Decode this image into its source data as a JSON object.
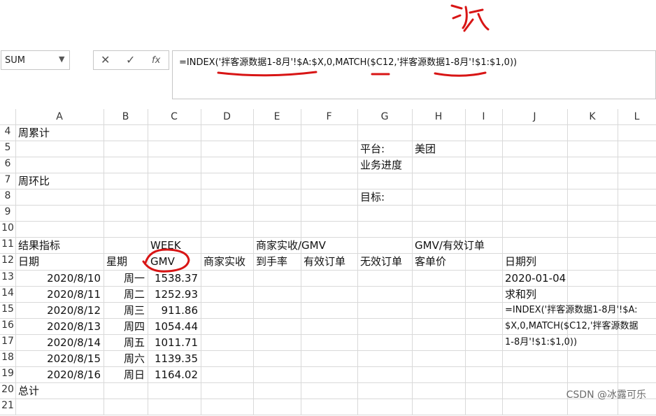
{
  "formula_bar": {
    "name_box": "SUM",
    "cancel_icon": "✕",
    "enter_icon": "✓",
    "fx_label": "fx",
    "formula": "=INDEX('拌客源数据1-8月'!$A:$X,0,MATCH($C12,'拌客源数据1-8月'!$1:$1,0))"
  },
  "column_headers": [
    "A",
    "B",
    "C",
    "D",
    "E",
    "F",
    "G",
    "H",
    "I",
    "J",
    "K",
    "L"
  ],
  "row_headers": [
    "4",
    "5",
    "6",
    "7",
    "8",
    "9",
    "10",
    "11",
    "12",
    "13",
    "14",
    "15",
    "16",
    "17",
    "18",
    "19",
    "20",
    "21"
  ],
  "cells": {
    "A4": "周累计",
    "G5": "平台:",
    "H5": "美团",
    "G6": "业务进度",
    "A7": "周环比",
    "G8": "目标:",
    "A11": "结果指标",
    "C11": "WEEK",
    "E11": "商家实收/GMV",
    "H11": "GMV/有效订单",
    "A12": "日期",
    "B12": "星期",
    "C12": "GMV",
    "D12": "商家实收",
    "E12": "到手率",
    "F12": "有效订单",
    "G12": "无效订单",
    "H12": "客单价",
    "J12": "日期列",
    "J13": "2020-01-04",
    "J14": "求和列",
    "J15": "=INDEX('拌客源数据1-8月'!$A:",
    "J16": "$X,0,MATCH($C12,'拌客源数据",
    "J17": "1-8月'!$1:$1,0))",
    "A20": "总计"
  },
  "data_rows": [
    {
      "date": "2020/8/10",
      "weekday": "周一",
      "gmv": "1538.37"
    },
    {
      "date": "2020/8/11",
      "weekday": "周二",
      "gmv": "1252.93"
    },
    {
      "date": "2020/8/12",
      "weekday": "周三",
      "gmv": "911.86"
    },
    {
      "date": "2020/8/13",
      "weekday": "周四",
      "gmv": "1054.44"
    },
    {
      "date": "2020/8/14",
      "weekday": "周五",
      "gmv": "1011.71"
    },
    {
      "date": "2020/8/15",
      "weekday": "周六",
      "gmv": "1139.35"
    },
    {
      "date": "2020/8/16",
      "weekday": "周日",
      "gmv": "1164.02"
    }
  ],
  "annotation": "冰",
  "watermark": "CSDN @冰露可乐",
  "colors": {
    "annotation_red": "#d81515",
    "grid": "#d9d9d9"
  }
}
